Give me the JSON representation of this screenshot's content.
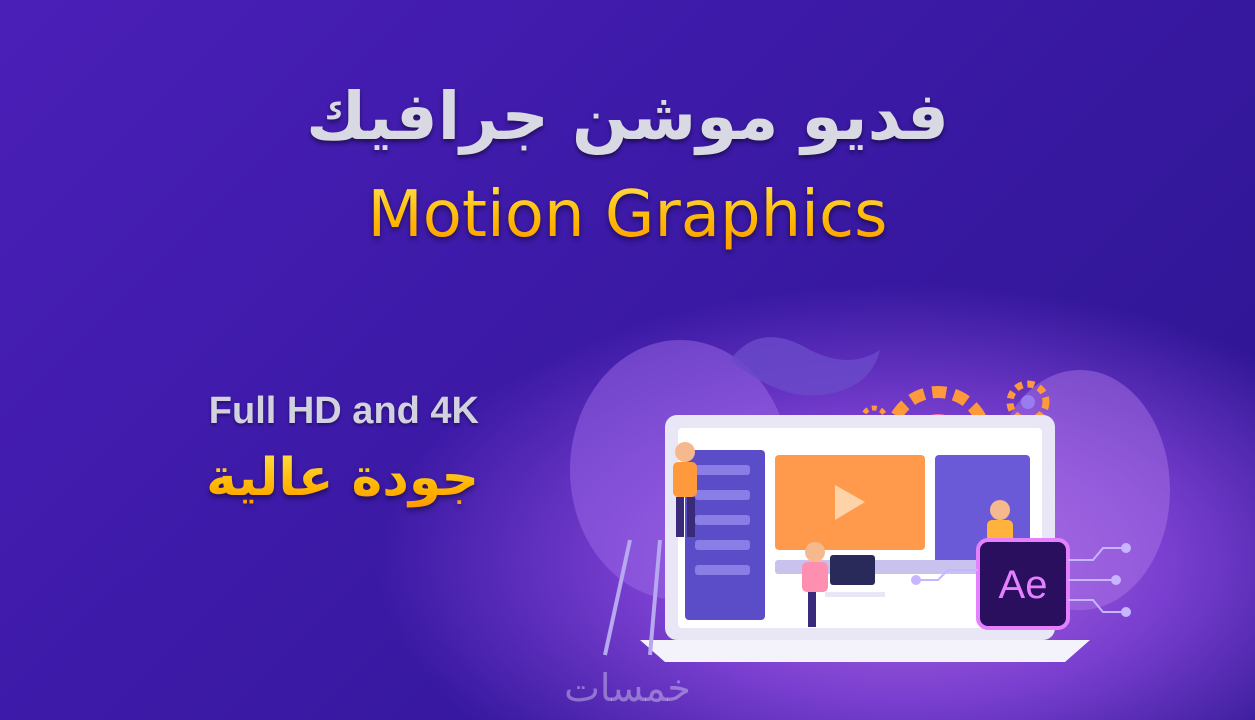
{
  "header": {
    "title_ar": "فديو موشن جرافيك",
    "title_en": "Motion Graphics"
  },
  "features": {
    "resolution": "Full HD and 4K",
    "quality_ar": "جودة عالية"
  },
  "illustration": {
    "app_badge_text": "Ae",
    "colors": {
      "laptop": "#e9e6f5",
      "screen_panel": "#5b4cc7",
      "video_panel": "#ff9a4d",
      "ae_badge_bg": "#2a0f5e",
      "ae_badge_border": "#e580ff",
      "gear_pink": "#ff6fa8",
      "gear_orange": "#ff9a3c"
    }
  },
  "watermark": {
    "text": "خمسات"
  },
  "theme": {
    "bg_dark": "#2b158f",
    "bg_light": "#b06adf",
    "title_gray": "#d9d9e3",
    "accent_gold": "#ffc21a"
  }
}
